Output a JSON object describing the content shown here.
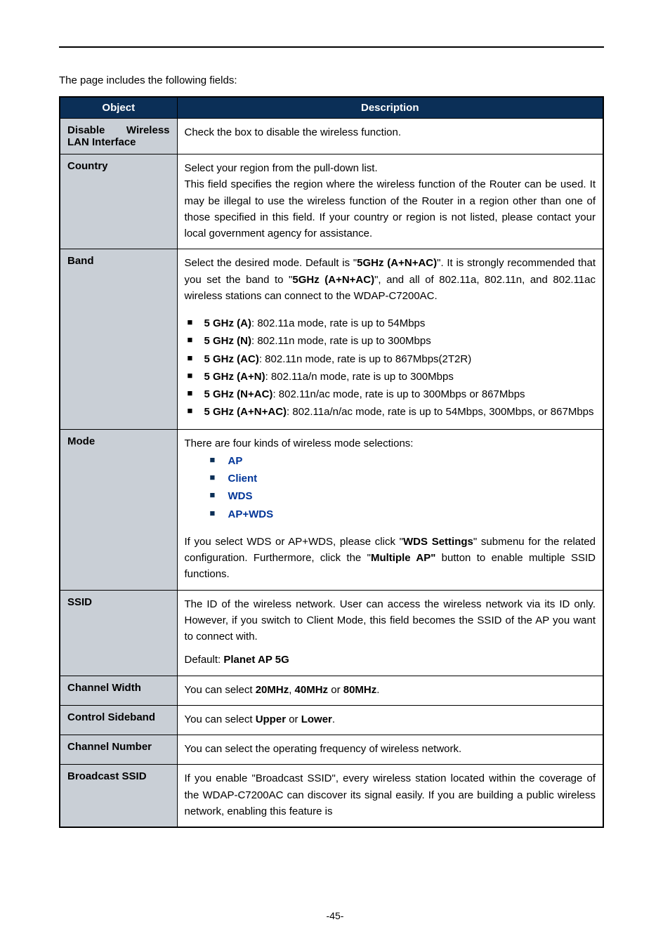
{
  "intro": "The page includes the following fields:",
  "header": {
    "object": "Object",
    "description": "Description"
  },
  "rows": {
    "disable": {
      "label": "Disable Wireless LAN Interface",
      "desc": "Check the box to disable the wireless function."
    },
    "country": {
      "label": "Country",
      "desc": "Select your region from the pull-down list.\nThis field specifies the region where the wireless function of the Router can be used. It may be illegal to use the wireless function of the Router in a region other than one of those specified in this field. If your country or region is not listed, please contact your local government agency for assistance."
    },
    "band": {
      "label": "Band",
      "intro_pre": "Select the desired mode. Default is \"",
      "intro_b1": "5GHz (A+N+AC)",
      "intro_mid": "\". It is strongly recommended that you set the band to \"",
      "intro_b2": "5GHz (A+N+AC)",
      "intro_post": "\", and all of 802.11a, 802.11n, and 802.11ac wireless stations can connect to the WDAP-C7200AC.",
      "items": [
        {
          "b": "5 GHz (A)",
          "t": ": 802.11a mode, rate is up to 54Mbps"
        },
        {
          "b": "5 GHz (N)",
          "t": ": 802.11n mode, rate is up to 300Mbps"
        },
        {
          "b": "5 GHz (AC)",
          "t": ": 802.11n mode, rate is up to 867Mbps(2T2R)"
        },
        {
          "b": "5 GHz (A+N)",
          "t": ": 802.11a/n mode, rate is up to 300Mbps"
        },
        {
          "b": "5 GHz (N+AC)",
          "t": ": 802.11n/ac mode, rate is up to 300Mbps or 867Mbps"
        },
        {
          "b": "5 GHz (A+N+AC)",
          "t": ": 802.11a/n/ac mode, rate is up to 54Mbps, 300Mbps, or 867Mbps"
        }
      ]
    },
    "mode": {
      "label": "Mode",
      "intro": "There are four kinds of wireless mode selections:",
      "options": [
        "AP",
        "Client",
        "WDS",
        "AP+WDS"
      ],
      "note_pre": "If you select WDS or AP+WDS, please click \"",
      "note_b1": "WDS Settings",
      "note_mid": "\" submenu for the related configuration. Furthermore, click the \"",
      "note_b2": "Multiple AP\"",
      "note_post": " button to enable multiple SSID functions."
    },
    "ssid": {
      "label": "SSID",
      "desc": "The ID of the wireless network. User can access the wireless network via its ID only. However, if you switch to Client Mode, this field becomes the SSID of the AP you want to connect with.",
      "default_pre": "Default: ",
      "default_b": "Planet AP 5G"
    },
    "cwidth": {
      "label": "Channel Width",
      "pre": "You can select ",
      "b1": "20MHz",
      "mid1": ", ",
      "b2": "40MHz",
      "mid2": " or ",
      "b3": "80MHz",
      "post": "."
    },
    "sideband": {
      "label": "Control Sideband",
      "pre": "You can select ",
      "b1": "Upper",
      "mid": " or ",
      "b2": "Lower",
      "post": "."
    },
    "cnum": {
      "label": "Channel Number",
      "desc": "You can select the operating frequency of wireless network."
    },
    "bssid": {
      "label": "Broadcast SSID",
      "desc": "If you enable \"Broadcast SSID\", every wireless station located within the coverage of the WDAP-C7200AC can discover its signal easily. If you are building a public wireless network, enabling this feature is"
    }
  },
  "page_number": "-45-"
}
